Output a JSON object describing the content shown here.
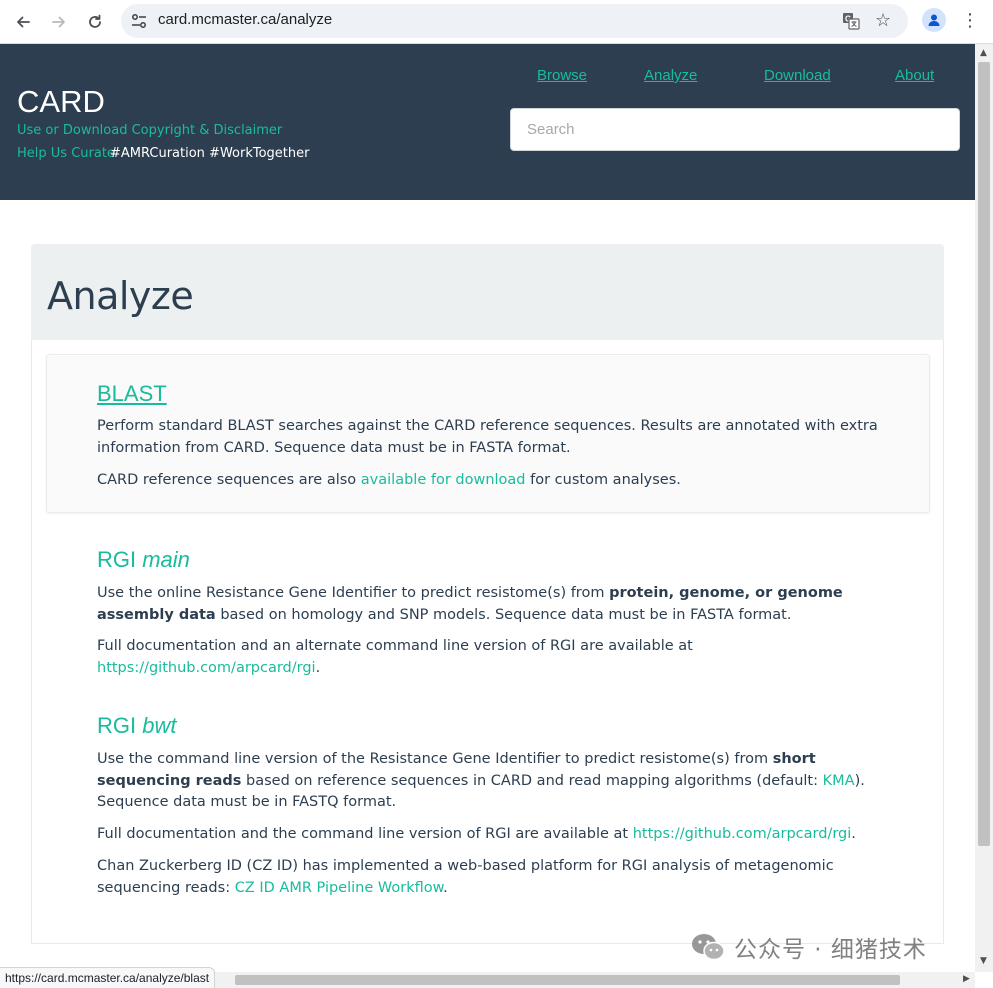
{
  "browser": {
    "url": "card.mcmaster.ca/analyze",
    "status_url": "https://card.mcmaster.ca/analyze/blast"
  },
  "header": {
    "logo": "CARD",
    "link_disclaimer": "Use or Download Copyright & Disclaimer",
    "link_curate": "Help Us Curate",
    "hashtags": "#AMRCuration #WorkTogether",
    "nav": [
      "Browse",
      "Analyze",
      "Download",
      "About"
    ],
    "search_placeholder": "Search"
  },
  "page": {
    "title": "Analyze"
  },
  "sections": {
    "blast": {
      "title": "BLAST",
      "p1": "Perform standard BLAST searches against the CARD reference sequences. Results are annotated with extra information from CARD. Sequence data must be in FASTA format.",
      "p2_pre": "CARD reference sequences are also ",
      "p2_link": "available for download",
      "p2_post": " for custom analyses."
    },
    "rgi_main": {
      "title_pre": "RGI ",
      "title_em": "main",
      "p1_pre": "Use the online Resistance Gene Identifier to predict resistome(s) from ",
      "p1_bold": "protein, genome, or genome assembly data",
      "p1_post": " based on homology and SNP models. Sequence data must be in FASTA format.",
      "p2_pre": "Full documentation and an alternate command line version of RGI are available at ",
      "p2_link": "https://github.com/arpcard/rgi",
      "p2_post": "."
    },
    "rgi_bwt": {
      "title_pre": "RGI ",
      "title_em": "bwt",
      "p1_pre": "Use the command line version of the Resistance Gene Identifier to predict resistome(s) from ",
      "p1_bold": "short sequencing reads",
      "p1_mid": " based on reference sequences in CARD and read mapping algorithms (default: ",
      "p1_link": "KMA",
      "p1_post": "). Sequence data must be in FASTQ format.",
      "p2_pre": "Full documentation and the command line version of RGI are available at ",
      "p2_link": "https://github.com/arpcard/rgi",
      "p2_post": ".",
      "p3_pre": "Chan Zuckerberg ID (CZ ID) has implemented a web-based platform for RGI analysis of metagenomic sequencing reads: ",
      "p3_link": "CZ ID AMR Pipeline Workflow",
      "p3_post": "."
    }
  },
  "watermark": {
    "text": "公众号 · 细猪技术"
  },
  "colors": {
    "header_bg": "#2c3e50",
    "accent": "#18bc9c",
    "jumbotron_bg": "#ecf0f1",
    "text": "#2c3e50"
  },
  "icons": {
    "back": "arrow-left-icon",
    "forward": "arrow-right-icon",
    "reload": "reload-icon",
    "site_info": "tune-icon",
    "translate": "translate-icon",
    "bookmark": "star-icon",
    "profile": "person-icon",
    "menu": "kebab-menu-icon"
  }
}
